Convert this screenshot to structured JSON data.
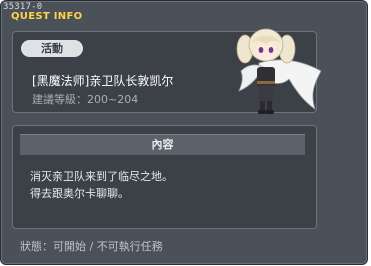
{
  "window": {
    "id_code": "35317-0",
    "title": "QUEST INFO"
  },
  "quest": {
    "category_badge": "活動",
    "name": "[黑魔法师]亲卫队长敦凯尔",
    "level_range": "建議等級：200~204"
  },
  "content": {
    "header": "內容",
    "lines": [
      "消灭亲卫队来到了临尽之地。",
      "得去跟奥尔卡聊聊。"
    ]
  },
  "status_text": "狀態：可開始 / 不可執行任務",
  "npc": {
    "icon": "npc-character-icon"
  },
  "colors": {
    "title": "#ffd24a",
    "background": "#4b5158",
    "panel": "#3c4148"
  }
}
